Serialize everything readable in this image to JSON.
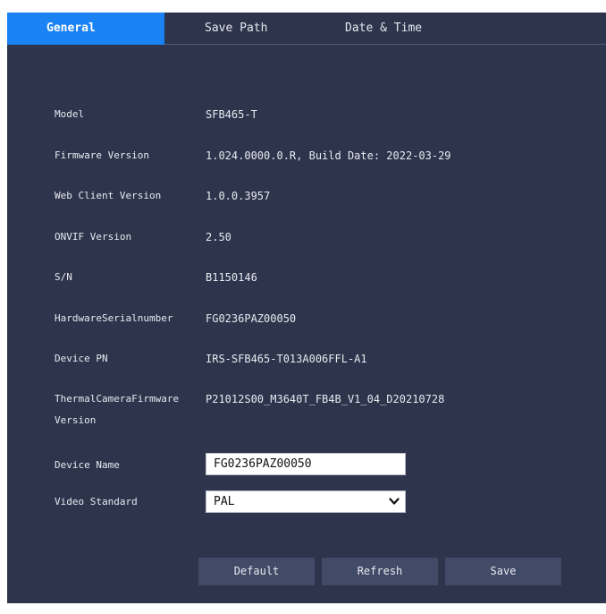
{
  "tabs": [
    {
      "label": "General",
      "active": true
    },
    {
      "label": "Save Path",
      "active": false
    },
    {
      "label": "Date & Time",
      "active": false
    }
  ],
  "info": {
    "model": {
      "label": "Model",
      "value": "SFB465-T"
    },
    "firmware": {
      "label": "Firmware Version",
      "value": "1.024.0000.0.R, Build Date: 2022-03-29"
    },
    "web_client": {
      "label": "Web Client Version",
      "value": "1.0.0.3957"
    },
    "onvif": {
      "label": "ONVIF Version",
      "value": "2.50"
    },
    "sn": {
      "label": "S/N",
      "value": "B1150146"
    },
    "hw_serial": {
      "label": "HardwareSerialnumber",
      "value": "FG0236PAZ00050"
    },
    "device_pn": {
      "label": "Device PN",
      "value": "IRS-SFB465-T013A006FFL-A1"
    },
    "thermal_fw": {
      "label_line1": "ThermalCameraFirmware",
      "label_line2": "Version",
      "value": "P21012S00_M3640T_FB4B_V1_04_D20210728"
    }
  },
  "device_name": {
    "label": "Device Name",
    "value": "FG0236PAZ00050"
  },
  "video_standard": {
    "label": "Video Standard",
    "value": "PAL"
  },
  "buttons": {
    "default": "Default",
    "refresh": "Refresh",
    "save": "Save"
  },
  "colors": {
    "panel_bg": "#2d344c",
    "active_tab": "#1b82f3",
    "button_bg": "#414a66"
  },
  "icons": {
    "select_arrow": "chevron-down-icon"
  }
}
